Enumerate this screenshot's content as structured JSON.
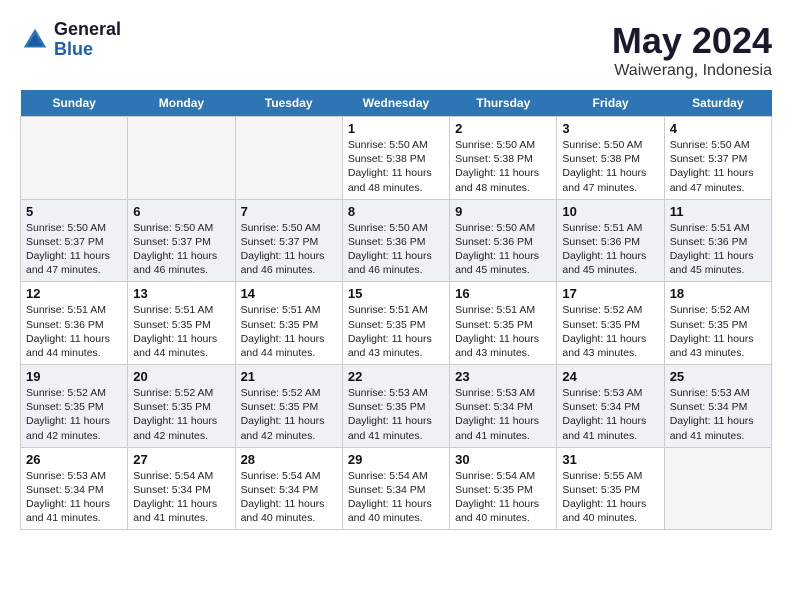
{
  "logo": {
    "general": "General",
    "blue": "Blue"
  },
  "title": "May 2024",
  "subtitle": "Waiwerang, Indonesia",
  "headers": [
    "Sunday",
    "Monday",
    "Tuesday",
    "Wednesday",
    "Thursday",
    "Friday",
    "Saturday"
  ],
  "weeks": [
    [
      {
        "date": "",
        "info": ""
      },
      {
        "date": "",
        "info": ""
      },
      {
        "date": "",
        "info": ""
      },
      {
        "date": "1",
        "info": "Sunrise: 5:50 AM\nSunset: 5:38 PM\nDaylight: 11 hours and 48 minutes."
      },
      {
        "date": "2",
        "info": "Sunrise: 5:50 AM\nSunset: 5:38 PM\nDaylight: 11 hours and 48 minutes."
      },
      {
        "date": "3",
        "info": "Sunrise: 5:50 AM\nSunset: 5:38 PM\nDaylight: 11 hours and 47 minutes."
      },
      {
        "date": "4",
        "info": "Sunrise: 5:50 AM\nSunset: 5:37 PM\nDaylight: 11 hours and 47 minutes."
      }
    ],
    [
      {
        "date": "5",
        "info": "Sunrise: 5:50 AM\nSunset: 5:37 PM\nDaylight: 11 hours and 47 minutes."
      },
      {
        "date": "6",
        "info": "Sunrise: 5:50 AM\nSunset: 5:37 PM\nDaylight: 11 hours and 46 minutes."
      },
      {
        "date": "7",
        "info": "Sunrise: 5:50 AM\nSunset: 5:37 PM\nDaylight: 11 hours and 46 minutes."
      },
      {
        "date": "8",
        "info": "Sunrise: 5:50 AM\nSunset: 5:36 PM\nDaylight: 11 hours and 46 minutes."
      },
      {
        "date": "9",
        "info": "Sunrise: 5:50 AM\nSunset: 5:36 PM\nDaylight: 11 hours and 45 minutes."
      },
      {
        "date": "10",
        "info": "Sunrise: 5:51 AM\nSunset: 5:36 PM\nDaylight: 11 hours and 45 minutes."
      },
      {
        "date": "11",
        "info": "Sunrise: 5:51 AM\nSunset: 5:36 PM\nDaylight: 11 hours and 45 minutes."
      }
    ],
    [
      {
        "date": "12",
        "info": "Sunrise: 5:51 AM\nSunset: 5:36 PM\nDaylight: 11 hours and 44 minutes."
      },
      {
        "date": "13",
        "info": "Sunrise: 5:51 AM\nSunset: 5:35 PM\nDaylight: 11 hours and 44 minutes."
      },
      {
        "date": "14",
        "info": "Sunrise: 5:51 AM\nSunset: 5:35 PM\nDaylight: 11 hours and 44 minutes."
      },
      {
        "date": "15",
        "info": "Sunrise: 5:51 AM\nSunset: 5:35 PM\nDaylight: 11 hours and 43 minutes."
      },
      {
        "date": "16",
        "info": "Sunrise: 5:51 AM\nSunset: 5:35 PM\nDaylight: 11 hours and 43 minutes."
      },
      {
        "date": "17",
        "info": "Sunrise: 5:52 AM\nSunset: 5:35 PM\nDaylight: 11 hours and 43 minutes."
      },
      {
        "date": "18",
        "info": "Sunrise: 5:52 AM\nSunset: 5:35 PM\nDaylight: 11 hours and 43 minutes."
      }
    ],
    [
      {
        "date": "19",
        "info": "Sunrise: 5:52 AM\nSunset: 5:35 PM\nDaylight: 11 hours and 42 minutes."
      },
      {
        "date": "20",
        "info": "Sunrise: 5:52 AM\nSunset: 5:35 PM\nDaylight: 11 hours and 42 minutes."
      },
      {
        "date": "21",
        "info": "Sunrise: 5:52 AM\nSunset: 5:35 PM\nDaylight: 11 hours and 42 minutes."
      },
      {
        "date": "22",
        "info": "Sunrise: 5:53 AM\nSunset: 5:35 PM\nDaylight: 11 hours and 41 minutes."
      },
      {
        "date": "23",
        "info": "Sunrise: 5:53 AM\nSunset: 5:34 PM\nDaylight: 11 hours and 41 minutes."
      },
      {
        "date": "24",
        "info": "Sunrise: 5:53 AM\nSunset: 5:34 PM\nDaylight: 11 hours and 41 minutes."
      },
      {
        "date": "25",
        "info": "Sunrise: 5:53 AM\nSunset: 5:34 PM\nDaylight: 11 hours and 41 minutes."
      }
    ],
    [
      {
        "date": "26",
        "info": "Sunrise: 5:53 AM\nSunset: 5:34 PM\nDaylight: 11 hours and 41 minutes."
      },
      {
        "date": "27",
        "info": "Sunrise: 5:54 AM\nSunset: 5:34 PM\nDaylight: 11 hours and 41 minutes."
      },
      {
        "date": "28",
        "info": "Sunrise: 5:54 AM\nSunset: 5:34 PM\nDaylight: 11 hours and 40 minutes."
      },
      {
        "date": "29",
        "info": "Sunrise: 5:54 AM\nSunset: 5:34 PM\nDaylight: 11 hours and 40 minutes."
      },
      {
        "date": "30",
        "info": "Sunrise: 5:54 AM\nSunset: 5:35 PM\nDaylight: 11 hours and 40 minutes."
      },
      {
        "date": "31",
        "info": "Sunrise: 5:55 AM\nSunset: 5:35 PM\nDaylight: 11 hours and 40 minutes."
      },
      {
        "date": "",
        "info": ""
      }
    ]
  ]
}
